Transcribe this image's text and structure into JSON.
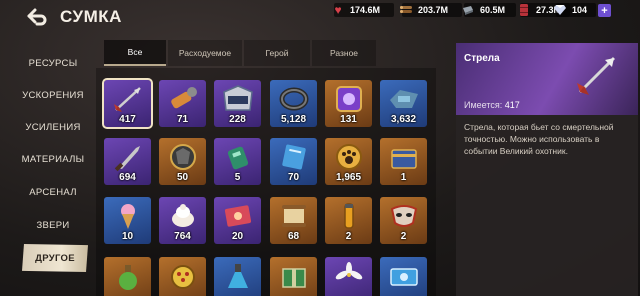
{
  "header": {
    "back_icon": "back-arrow-icon",
    "title": "СУМКА"
  },
  "resources": [
    {
      "icon": "heart-meat-icon",
      "value": "174.6M"
    },
    {
      "icon": "wood-logs-icon",
      "value": "203.7M"
    },
    {
      "icon": "steel-icon",
      "value": "60.5M"
    },
    {
      "icon": "oil-barrel-icon",
      "value": "27.3M"
    },
    {
      "icon": "diamond-icon",
      "value": "104"
    }
  ],
  "plus_label": "+",
  "sidebar": {
    "items": [
      {
        "label": "РЕСУРСЫ"
      },
      {
        "label": "УСКОРЕНИЯ"
      },
      {
        "label": "УСИЛЕНИЯ"
      },
      {
        "label": "МАТЕРИАЛЫ"
      },
      {
        "label": "АРСЕНАЛ"
      },
      {
        "label": "ЗВЕРИ"
      },
      {
        "label": "ДРУГОЕ"
      }
    ],
    "active_index": 6
  },
  "tabs": [
    {
      "label": "Все"
    },
    {
      "label": "Расходуемое"
    },
    {
      "label": "Герой"
    },
    {
      "label": "Разное"
    }
  ],
  "items": [
    {
      "qty": "417",
      "icon": "arrow-icon",
      "rarity": "purple"
    },
    {
      "qty": "71",
      "icon": "flashlight-icon",
      "rarity": "purple"
    },
    {
      "qty": "228",
      "icon": "dls5-badge-icon",
      "rarity": "purple"
    },
    {
      "qty": "5,128",
      "icon": "ring-icon",
      "rarity": "blue"
    },
    {
      "qty": "131",
      "icon": "purple-rune-icon",
      "rarity": "orange"
    },
    {
      "qty": "3,632",
      "icon": "gear-part-icon",
      "rarity": "blue"
    },
    {
      "qty": "694",
      "icon": "knife-icon",
      "rarity": "purple"
    },
    {
      "qty": "50",
      "icon": "shield-badge-icon",
      "rarity": "orange"
    },
    {
      "qty": "5",
      "icon": "radio-device-icon",
      "rarity": "purple"
    },
    {
      "qty": "70",
      "icon": "blue-card-icon",
      "rarity": "blue"
    },
    {
      "qty": "1,965",
      "icon": "paw-print-icon",
      "rarity": "orange"
    },
    {
      "qty": "1",
      "icon": "blue-chest-icon",
      "rarity": "orange"
    },
    {
      "qty": "10",
      "icon": "ice-cream-icon",
      "rarity": "blue"
    },
    {
      "qty": "764",
      "icon": "cream-dessert-icon",
      "rarity": "purple"
    },
    {
      "qty": "20",
      "icon": "ticket-icon",
      "rarity": "purple"
    },
    {
      "qty": "68",
      "icon": "scroll-icon",
      "rarity": "orange"
    },
    {
      "qty": "2",
      "icon": "vial-icon",
      "rarity": "orange"
    },
    {
      "qty": "2",
      "icon": "mask-icon",
      "rarity": "orange"
    },
    {
      "qty": "",
      "icon": "potion-bottle-icon",
      "rarity": "orange"
    },
    {
      "qty": "",
      "icon": "lock-sphere-icon",
      "rarity": "orange"
    },
    {
      "qty": "",
      "icon": "flask-icon",
      "rarity": "blue"
    },
    {
      "qty": "",
      "icon": "green-box-icon",
      "rarity": "orange"
    },
    {
      "qty": "",
      "icon": "lily-flower-icon",
      "rarity": "purple"
    },
    {
      "qty": "",
      "icon": "blue-ticket-icon",
      "rarity": "blue"
    }
  ],
  "selected_index": 0,
  "detail": {
    "name": "Стрела",
    "owned_label": "Имеется:",
    "owned_value": "417",
    "icon": "arrow-icon",
    "description": "Стрела, которая бьет со смертельной точностью. Можно использовать в событии Великий охотник."
  }
}
